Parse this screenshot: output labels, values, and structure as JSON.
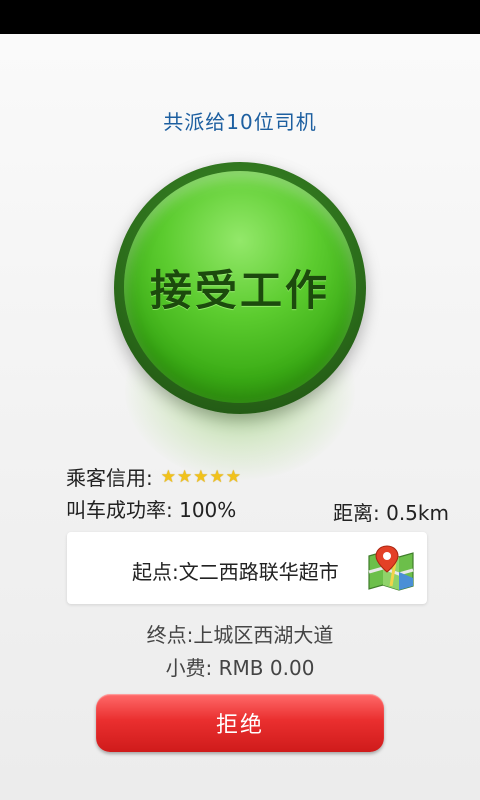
{
  "header": {
    "dispatch_text": "共派给10位司机"
  },
  "accept_button": {
    "label": "接受工作"
  },
  "passenger": {
    "credit_label": "乘客信用:",
    "credit_stars": 5,
    "success_rate_text": "叫车成功率: 100%"
  },
  "distance_text": "距离: 0.5km",
  "trip": {
    "start_text": "起点:文二西路联华超市",
    "end_text": "终点:上城区西湖大道",
    "tip_text": "小费:  RMB 0.00"
  },
  "reject_button": {
    "label": "拒绝"
  },
  "icons": {
    "star": "star-icon",
    "map": "map-location-icon"
  },
  "colors": {
    "accept_green": "#4cbf22",
    "reject_red": "#e53030",
    "title_blue": "#1d5fa0",
    "star_gold": "#f1c21b"
  }
}
